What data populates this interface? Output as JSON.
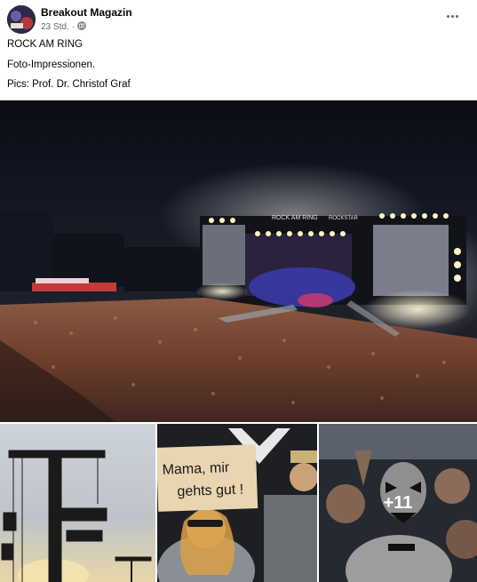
{
  "post": {
    "author": "Breakout Magazin",
    "timestamp": "23 Std.",
    "separator": "·",
    "audience_icon": "globe-icon",
    "more_icon": "more-options-icon",
    "lines": [
      "ROCK AM RING",
      "Foto-Impressionen.",
      "Pics: Prof. Dr. Christof Graf"
    ]
  },
  "photos": {
    "main_screen_text_left": "ROCK AM RING",
    "main_screen_text_right": "ROCKSTAR",
    "sign_text_line1": "Mama, mir",
    "sign_text_line2": "gehts gut !",
    "more_count": "+11"
  },
  "colors": {
    "meta_text": "#65676b",
    "stage_light": "#fff3c0",
    "crowd": "#7a4a36"
  }
}
